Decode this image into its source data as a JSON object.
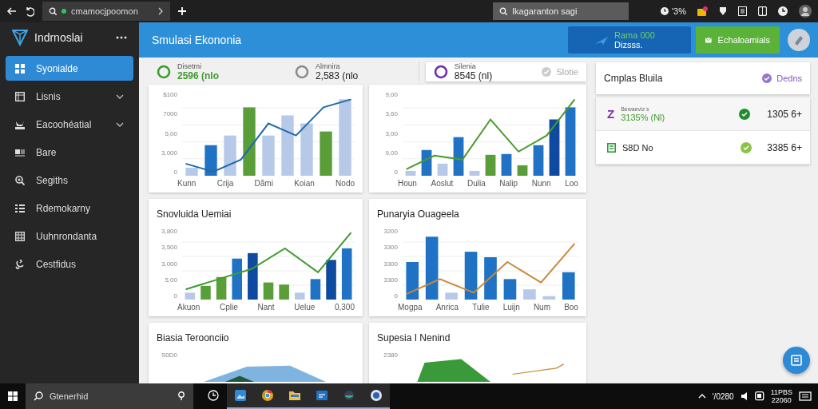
{
  "browser": {
    "tab": {
      "title": "cmamocjpoomon"
    },
    "address": {
      "value": "Ikagaranton sagi"
    },
    "status_text": "'3%"
  },
  "sidebar": {
    "title": "Indrnoslai",
    "items": [
      {
        "label": "Syonialde",
        "selected": true,
        "expandable": false
      },
      {
        "label": "Lisnis",
        "selected": false,
        "expandable": true
      },
      {
        "label": "Eacoohéatial",
        "selected": false,
        "expandable": true
      },
      {
        "label": "Bare",
        "selected": false,
        "expandable": false
      },
      {
        "label": "Segiths",
        "selected": false,
        "expandable": false
      },
      {
        "label": "Rdemokarny",
        "selected": false,
        "expandable": false
      },
      {
        "label": "Uuhnrondanta",
        "selected": false,
        "expandable": false
      },
      {
        "label": "Cestfidus",
        "selected": false,
        "expandable": false
      }
    ]
  },
  "header": {
    "title": "Smulasi Ekononia",
    "primary_button": {
      "line_1": "Rama 000",
      "line_2": "Dizsss."
    },
    "secondary_button": {
      "label": "Echaloamials"
    }
  },
  "stats": [
    {
      "kind": "plain",
      "label": "Disetmi",
      "value": "2596 (nlo",
      "emphasized": true,
      "color": "#3f9b2f"
    },
    {
      "kind": "plain",
      "label": "Almnira",
      "value": "2,583 (nlo",
      "emphasized": false,
      "color": "#8c8c8c"
    },
    {
      "kind": "card",
      "label": "Silenia",
      "value": "8545 (nl)",
      "emphasized": false,
      "color": "#6b2fa6",
      "action": "Slotie"
    }
  ],
  "charts": [
    {
      "kind": "bar",
      "y_labels": [
        "$100",
        "7000",
        "5,00",
        "3,000",
        "0"
      ],
      "x_labels": [
        "Kunn",
        "Crija",
        "Dãmi",
        "Koian",
        "Nodo"
      ]
    },
    {
      "kind": "bar",
      "y_labels": [
        "9,00",
        "3,60",
        "3,00",
        "9,00",
        "0"
      ],
      "x_labels": [
        "Houn",
        "Aoslut",
        "Dulia",
        "Nalip",
        "Nunn",
        "Loo"
      ]
    },
    {
      "kind": "bar",
      "title": "Snovluida Uemiai",
      "y_labels": [
        "3,800",
        "3,500",
        "3,000",
        "5,00",
        "0"
      ],
      "x_labels": [
        "Akuon",
        "Cplie",
        "Nant",
        "Uelue",
        "0,300"
      ]
    },
    {
      "kind": "bar",
      "title": "Punaryia Ouageela",
      "y_labels": [
        "3200",
        "3300",
        "3300",
        "3300",
        "0"
      ],
      "x_labels": [
        "Mogpa",
        "Anrica",
        "Tulie",
        "Luijn",
        "Num",
        "Boo"
      ]
    },
    {
      "kind": "area",
      "title": "Biasia Teroonciio",
      "y_labels": [
        "S0D0"
      ]
    },
    {
      "kind": "area",
      "title": "Supesia I Nenind",
      "y_labels": [
        "2380"
      ]
    }
  ],
  "summary": {
    "title": "Cmplas Bluila",
    "action": "Dedns"
  },
  "list": [
    {
      "icon_label": "Z",
      "caption": "Bewaeviz s",
      "value": "3135% (Nl)",
      "amount": "1305 6+",
      "color": "#1e8e2e"
    },
    {
      "value": "S8D No",
      "amount": "3385 6+",
      "color": "#8bc34a"
    }
  ],
  "taskbar": {
    "search": {
      "placeholder": "Gtenerhid"
    },
    "tray_text": "'/0280",
    "clock": {
      "time": "11PBS",
      "date": "22060"
    }
  }
}
